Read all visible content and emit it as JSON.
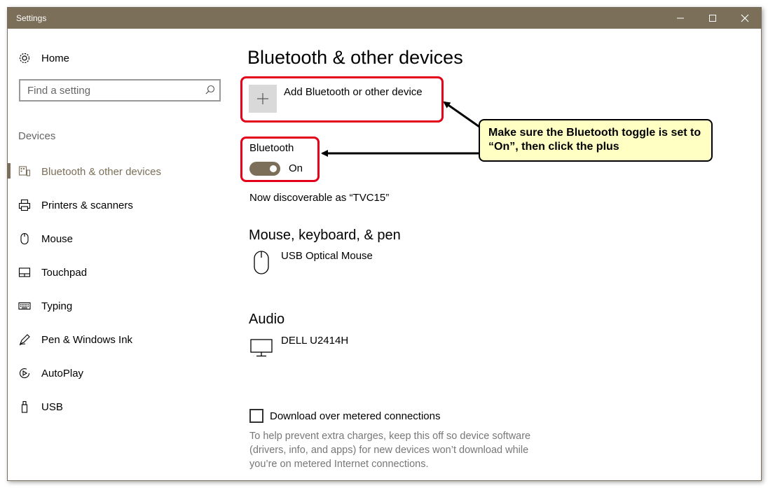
{
  "window": {
    "title": "Settings"
  },
  "titlebar_buttons": [
    "minimize-icon",
    "maximize-icon",
    "close-icon"
  ],
  "sidebar": {
    "home_label": "Home",
    "search_placeholder": "Find a setting",
    "section_label": "Devices",
    "items": [
      {
        "label": "Bluetooth & other devices",
        "icon": "bluetooth-devices-icon",
        "active": true
      },
      {
        "label": "Printers & scanners",
        "icon": "printer-icon",
        "active": false
      },
      {
        "label": "Mouse",
        "icon": "mouse-icon",
        "active": false
      },
      {
        "label": "Touchpad",
        "icon": "touchpad-icon",
        "active": false
      },
      {
        "label": "Typing",
        "icon": "keyboard-icon",
        "active": false
      },
      {
        "label": "Pen & Windows Ink",
        "icon": "pen-icon",
        "active": false
      },
      {
        "label": "AutoPlay",
        "icon": "autoplay-icon",
        "active": false
      },
      {
        "label": "USB",
        "icon": "usb-icon",
        "active": false
      }
    ]
  },
  "main": {
    "title": "Bluetooth & other devices",
    "add_device_label": "Add Bluetooth or other device",
    "bluetooth_label": "Bluetooth",
    "bluetooth_state": "On",
    "discoverable_text": "Now discoverable as “TVC15”",
    "groups": [
      {
        "title": "Mouse, keyboard, & pen",
        "devices": [
          {
            "name": "USB Optical Mouse",
            "icon": "mouse-icon"
          }
        ]
      },
      {
        "title": "Audio",
        "devices": [
          {
            "name": "DELL U2414H",
            "icon": "monitor-icon"
          }
        ]
      }
    ],
    "metered_label": "Download over metered connections",
    "metered_checked": false,
    "metered_help": "To help prevent extra charges, keep this off so device software (drivers, info, and apps) for new devices won’t download while you’re on metered Internet connections."
  },
  "annotation": {
    "callout_text": "Make sure the Bluetooth toggle is set to “On”, then click the plus",
    "highlight_color": "#e2001a",
    "callout_bg": "#ffffc4"
  },
  "colors": {
    "accent": "#7b6f59",
    "titlebar": "#7b6f59"
  }
}
